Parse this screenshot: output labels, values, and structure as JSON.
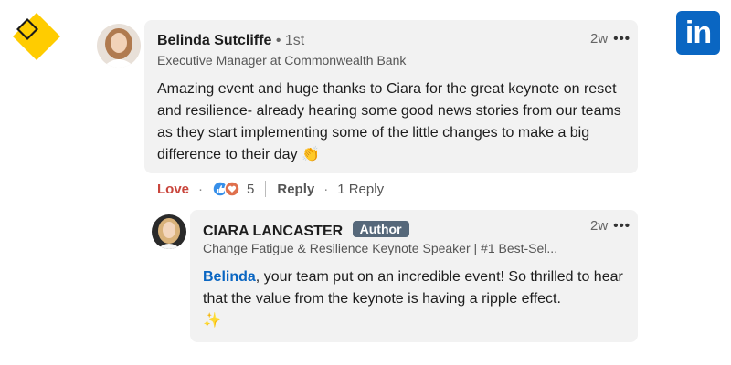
{
  "comment": {
    "author": "Belinda Sutcliffe",
    "degree": "1st",
    "headline": "Executive Manager at Commonwealth Bank",
    "time": "2w",
    "text": "Amazing event and huge thanks to Ciara for the great keynote on reset and resilience- already hearing some good news stories from our teams as they start implementing some of the little changes to make a big difference to their day",
    "text_emoji": "👏"
  },
  "actions": {
    "love_label": "Love",
    "reaction_count": "5",
    "reply_label": "Reply",
    "replies_label": "1 Reply"
  },
  "reply": {
    "author": "CIARA LANCASTER",
    "badge": "Author",
    "headline": "Change Fatigue & Resilience Keynote Speaker | #1 Best-Sel...",
    "time": "2w",
    "mention": "Belinda",
    "text": ", your team put on an incredible event! So thrilled to hear that the value from the keynote is having a ripple effect.",
    "emoji": "✨"
  },
  "colors": {
    "linkedin_blue": "#0a66c2",
    "brand_yellow": "#ffcc00",
    "love_red": "#c9463d"
  },
  "icons": [
    "commbank-diamond-logo",
    "linkedin-logo",
    "more-icon",
    "like-reaction-icon",
    "love-reaction-icon",
    "clapping-emoji",
    "sparkle-emoji"
  ]
}
